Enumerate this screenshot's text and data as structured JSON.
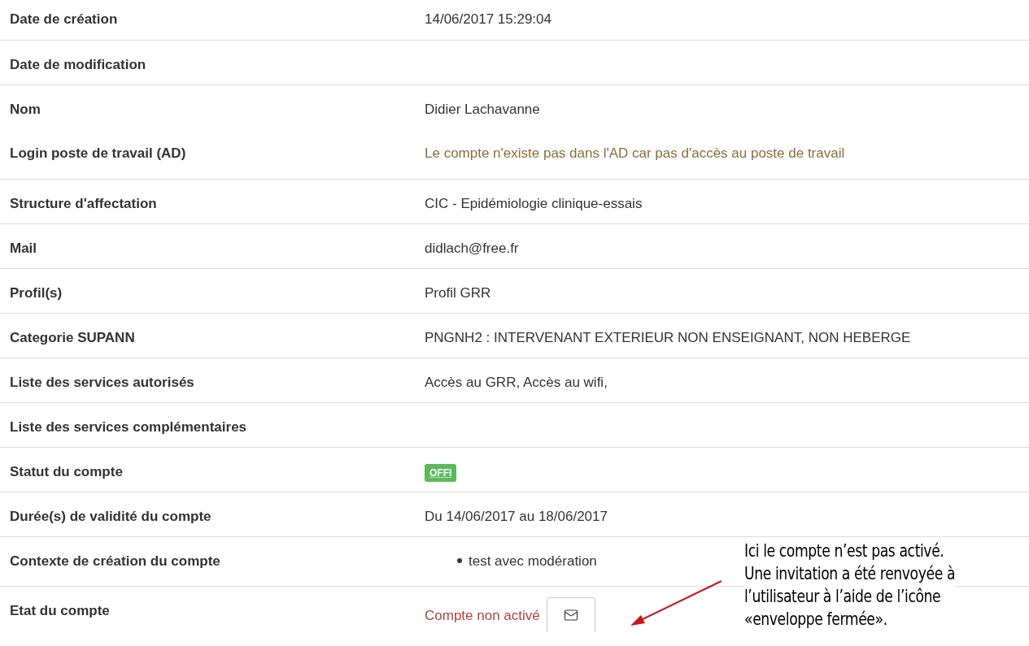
{
  "rows": [
    {
      "label": "Date de création",
      "kind": "text",
      "value": "14/06/2017 15:29:04"
    },
    {
      "label": "Date de modification",
      "kind": "text",
      "value": ""
    },
    {
      "label": "Nom",
      "kind": "text",
      "value": "Didier Lachavanne"
    },
    {
      "label": "Login poste de travail (AD)",
      "kind": "warning",
      "value": "Le compte n'existe pas dans l'AD car pas d'accès au poste de travail"
    },
    {
      "label": "Structure d'affectation",
      "kind": "text",
      "value": "CIC - Epidémiologie clinique-essais"
    },
    {
      "label": "Mail",
      "kind": "text",
      "value": "didlach@free.fr"
    },
    {
      "label": "Profil(s)",
      "kind": "text",
      "value": "Profil GRR"
    },
    {
      "label": "Categorie SUPANN",
      "kind": "text",
      "value": "PNGNH2 : INTERVENANT EXTERIEUR NON ENSEIGNANT, NON HEBERGE"
    },
    {
      "label": "Liste des services autorisés",
      "kind": "text",
      "value": "Accès au GRR, Accès au wifi,"
    },
    {
      "label": "Liste des services complémentaires",
      "kind": "text",
      "value": ""
    },
    {
      "label": "Statut du compte",
      "kind": "badge",
      "value": "OFFI",
      "color": "#5cb85c"
    },
    {
      "label": "Durée(s) de validité du compte",
      "kind": "text",
      "value": "Du 14/06/2017 au 18/06/2017"
    },
    {
      "label": "Contexte de création du compte",
      "kind": "list",
      "items": [
        "test avec modération"
      ]
    },
    {
      "label": "Etat du compte",
      "kind": "danger",
      "value": "Compte non activé"
    }
  ],
  "annotation": {
    "lines": [
      "Ici le compte n’est pas activé.",
      "Une invitation a été renvoyée à",
      "l’utilisateur à l’aide de l’icône",
      "«enveloppe fermée»."
    ]
  }
}
